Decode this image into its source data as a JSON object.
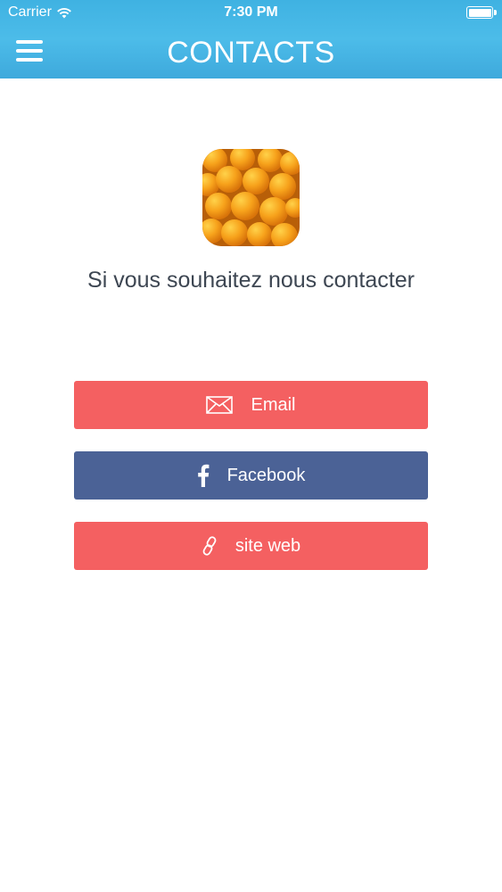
{
  "status": {
    "carrier": "Carrier",
    "time": "7:30 PM"
  },
  "nav": {
    "title": "CONTACTS"
  },
  "content": {
    "headline": "Si vous souhaitez nous contacter"
  },
  "buttons": {
    "email": {
      "label": "Email",
      "icon": "envelope-icon",
      "color": "#f46061"
    },
    "facebook": {
      "label": "Facebook",
      "icon": "facebook-icon",
      "color": "#4b6296"
    },
    "site": {
      "label": "site web",
      "icon": "link-icon",
      "color": "#f46061"
    }
  },
  "colors": {
    "header": "#45b6e6",
    "text": "#3d4652"
  }
}
